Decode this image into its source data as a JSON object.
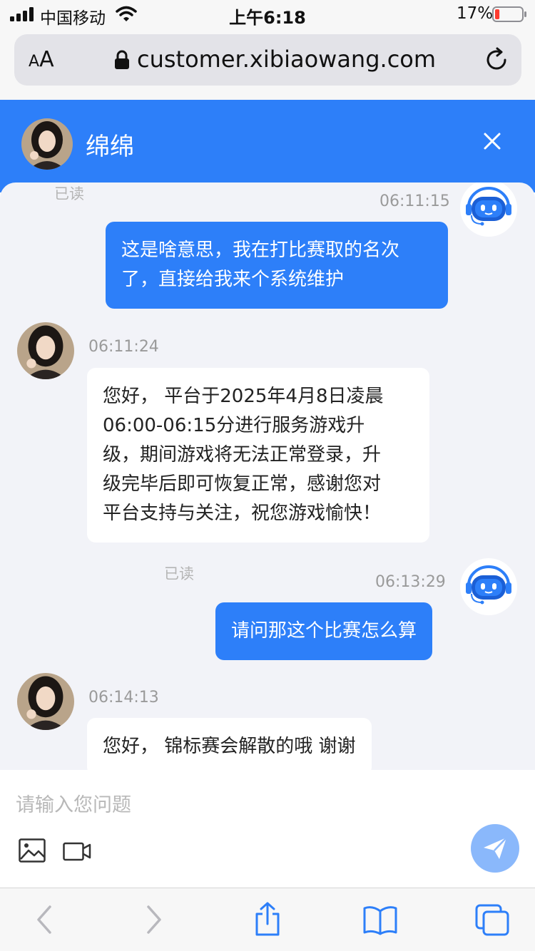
{
  "status_bar": {
    "carrier": "中国移动",
    "time": "上午6:18",
    "battery_percent": "17%",
    "battery_level": 0.17,
    "icons": [
      "signal-icon",
      "wifi-icon",
      "battery-icon"
    ]
  },
  "browser": {
    "text_size_label_small": "A",
    "text_size_label_large": "A",
    "url": "customer.xibiaowang.com",
    "icons": [
      "lock-icon",
      "reload-icon"
    ]
  },
  "chat_header": {
    "agent_name": "绵绵",
    "icons": [
      "close-icon"
    ]
  },
  "messages": [
    {
      "direction": "out",
      "read_label": "已读",
      "time": "06:11:15",
      "lines": [
        "这是啥意思，我在打比赛取的名次",
        "了，直接给我来个系统维护"
      ]
    },
    {
      "direction": "in",
      "time": "06:11:24",
      "lines": [
        "您好， 平台于2025年4月8日凌晨",
        "06:00-06:15分进行服务游戏升",
        "级，期间游戏将无法正常登录，升",
        "级完毕后即可恢复正常，感谢您对",
        "平台支持与关注，祝您游戏愉快！"
      ]
    },
    {
      "direction": "out",
      "read_label": "已读",
      "time": "06:13:29",
      "lines": [
        "请问那这个比赛怎么算"
      ]
    },
    {
      "direction": "in",
      "time": "06:14:13",
      "lines": [
        "您好， 锦标赛会解散的哦  谢谢"
      ]
    }
  ],
  "input": {
    "placeholder": "请输入您问题",
    "value": "",
    "icons": [
      "image-icon",
      "video-icon",
      "send-icon"
    ]
  },
  "toolbar": {
    "icons": [
      "back-icon",
      "forward-icon",
      "share-icon",
      "bookmarks-icon",
      "tabs-icon"
    ]
  },
  "colors": {
    "accent": "#2d7ff9",
    "chat_background": "#f2f3f8",
    "send_button": "#8ab8fb",
    "battery_low": "#ff3b30"
  }
}
